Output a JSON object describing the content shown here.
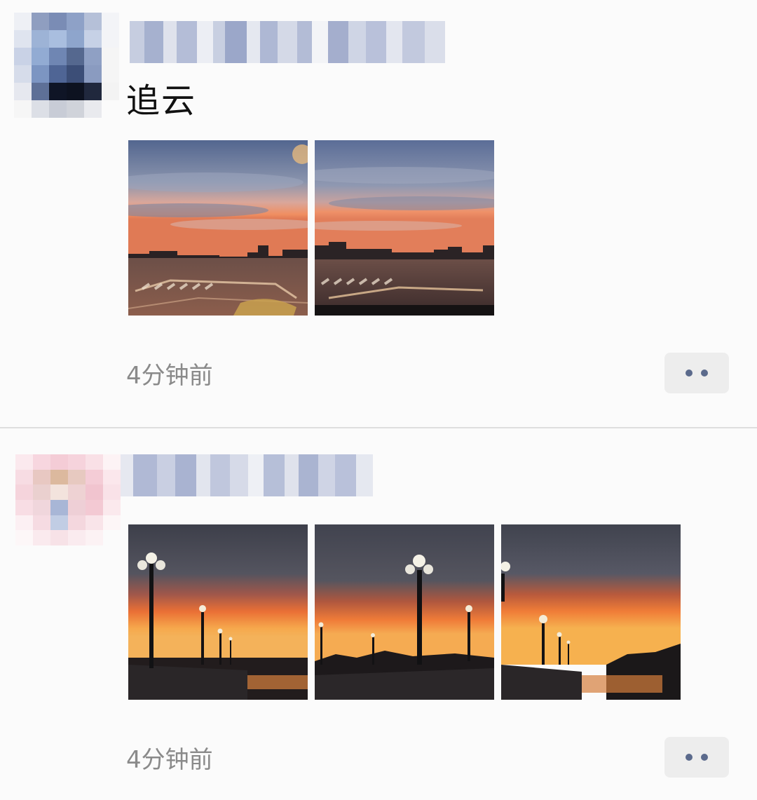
{
  "posts": [
    {
      "text": "追云",
      "time": "4分钟前",
      "photos": [
        "sunset-street-photo",
        "sunset-street-photo"
      ],
      "more_icon": "ellipsis-icon"
    },
    {
      "text": "",
      "time": "4分钟前",
      "photos": [
        "sunset-bridge-lamps-photo",
        "sunset-bridge-lamps-photo",
        "sunset-bridge-lamps-photo"
      ],
      "more_icon": "ellipsis-icon"
    }
  ],
  "colors": {
    "background": "#fbfbfb",
    "divider": "#dedede",
    "time_text": "#8a8a8a",
    "more_dots": "#5b6a8c"
  }
}
